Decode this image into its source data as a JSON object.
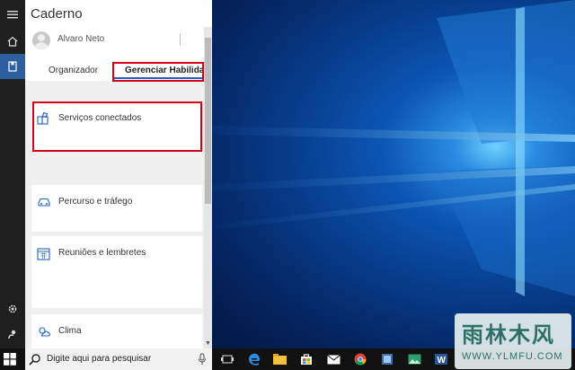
{
  "panel": {
    "title": "Caderno",
    "user_name": "Alvaro Neto",
    "tabs": [
      {
        "label": "Organizador",
        "active": false
      },
      {
        "label": "Gerenciar Habilidades",
        "active": true
      }
    ]
  },
  "cards": [
    {
      "label": "Serviços conectados",
      "icon": "connected-services-icon",
      "highlighted": true
    },
    {
      "label": "Percurso e tráfego",
      "icon": "car-icon"
    },
    {
      "label": "Reuniões e lembretes",
      "icon": "calendar-icon"
    },
    {
      "label": "Clima",
      "icon": "weather-icon"
    }
  ],
  "rail": {
    "items": [
      "hamburger-menu-icon",
      "notebook-icon",
      "home-icon",
      "settings-icon",
      "feedback-icon"
    ]
  },
  "taskbar": {
    "search_placeholder": "Digite aqui para pesquisar",
    "apps": [
      "task-view-icon",
      "edge-icon",
      "file-explorer-icon",
      "store-icon",
      "mail-icon",
      "chrome-icon",
      "app-icon",
      "photos-icon",
      "word-icon"
    ]
  },
  "watermark": {
    "logo": "雨林木风",
    "url": "WWW.YLMFU.COM"
  },
  "colors": {
    "accent": "#1f62c5",
    "highlight": "#d4001a",
    "rail": "#1f1f1f",
    "taskbar": "#111111"
  }
}
